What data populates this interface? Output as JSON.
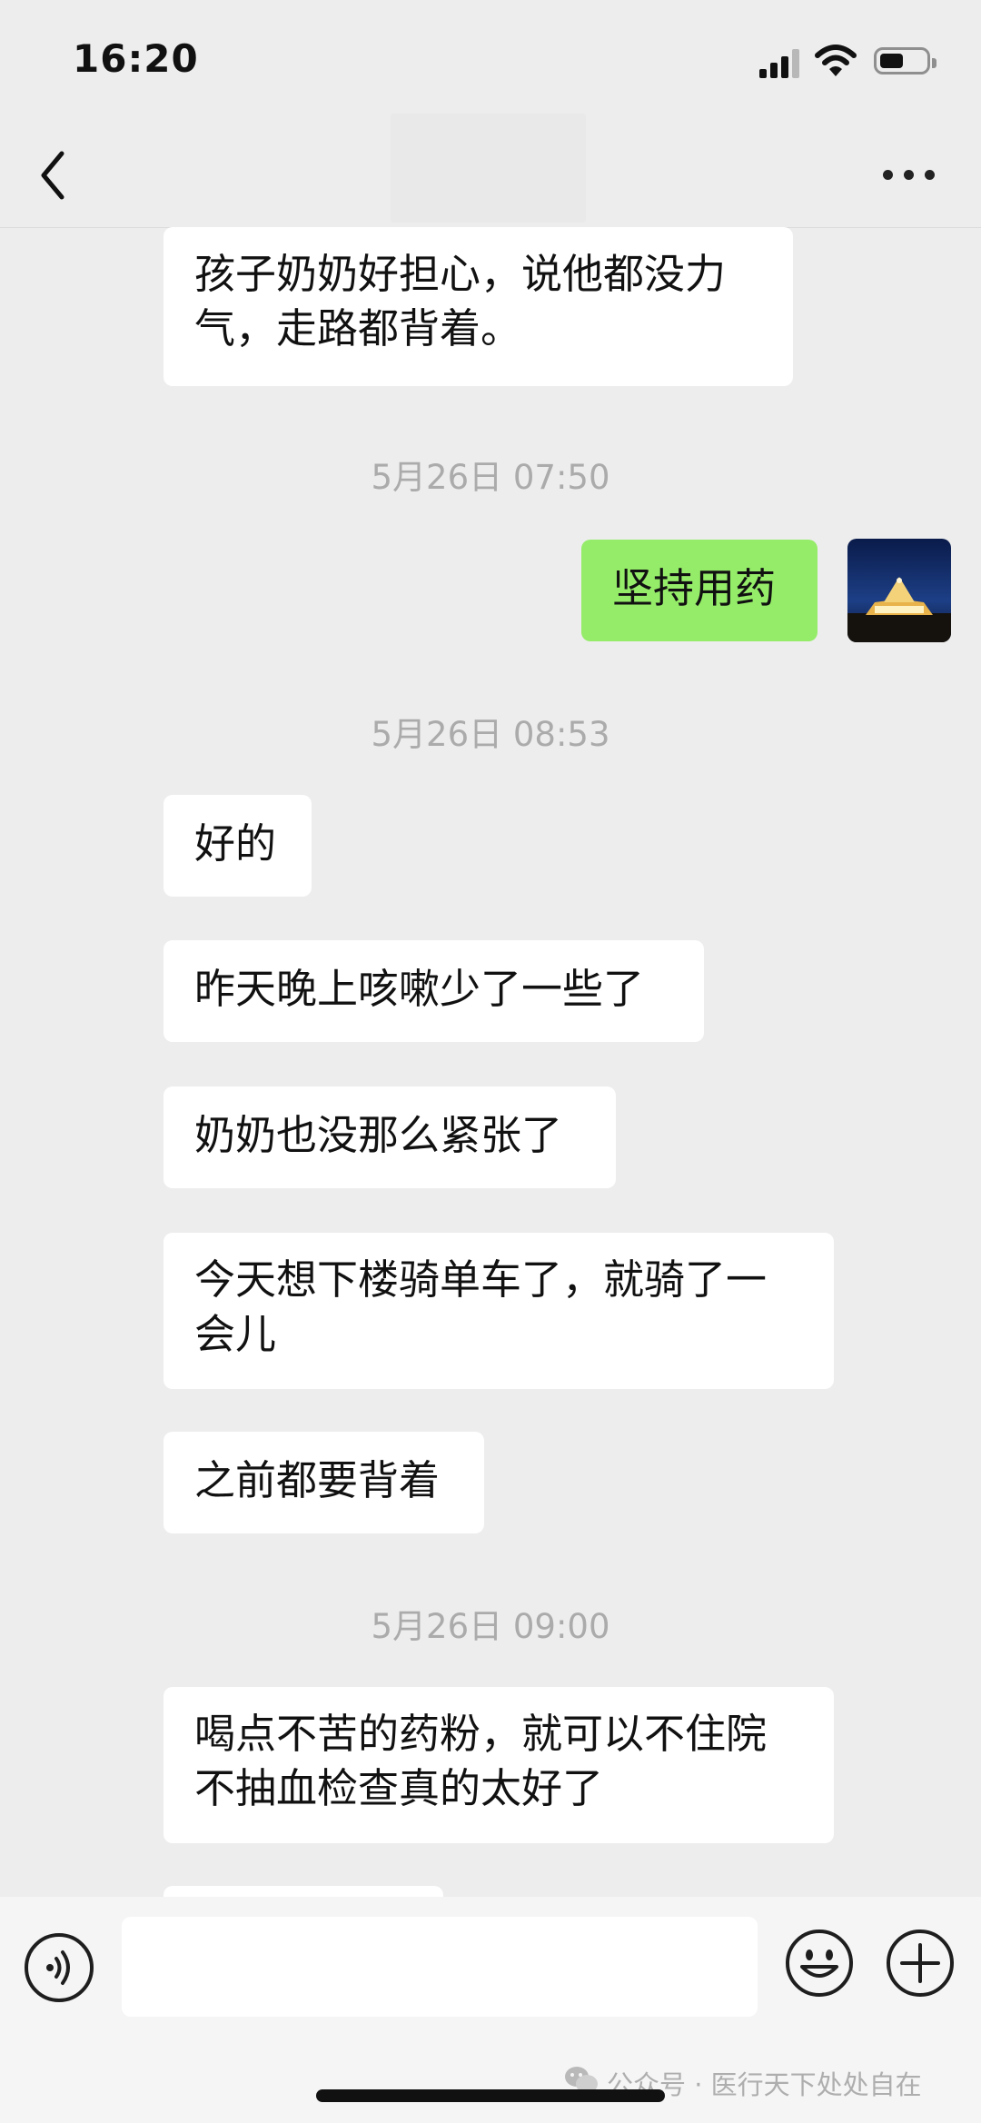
{
  "status_bar": {
    "time": "16:20"
  },
  "header": {
    "title": ""
  },
  "messages": {
    "m1": "孩子奶奶好担心，说他都没力气，走路都背着。",
    "ts1": "5月26日 07:50",
    "m2": "坚持用药",
    "ts2": "5月26日 08:53",
    "m3": "好的",
    "m4": "昨天晚上咳嗽少了一些了",
    "m5": "奶奶也没那么紧张了",
    "m6": "今天想下楼骑单车了，就骑了一会儿",
    "m7": "之前都要背着",
    "ts3": "5月26日 09:00",
    "m8": "喝点不苦的药粉，就可以不住院不抽血检查真的太好了",
    "m9": ""
  },
  "input_bar": {
    "value": "",
    "placeholder": ""
  },
  "watermark": {
    "text": "公众号 · 医行天下处处自在"
  },
  "colors": {
    "background": "#ededed",
    "sent_bubble": "#95ec69",
    "received_bubble": "#ffffff"
  }
}
